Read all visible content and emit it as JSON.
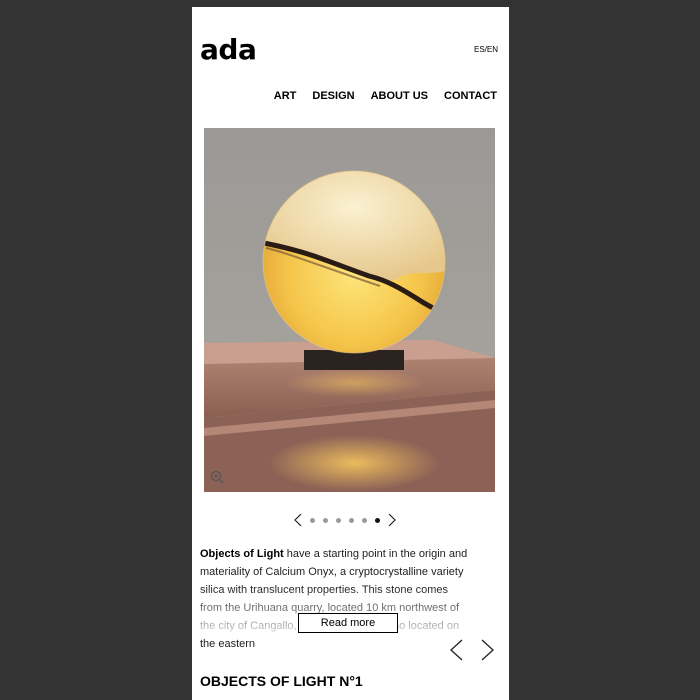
{
  "header": {
    "logo": "ada",
    "lang_switch": "ES/EN"
  },
  "nav": {
    "items": [
      {
        "label": "ART"
      },
      {
        "label": "DESIGN"
      },
      {
        "label": "ABOUT US"
      },
      {
        "label": "CONTACT"
      }
    ]
  },
  "hero": {
    "icon": "zoom-icon"
  },
  "carousel": {
    "slide_count": 6,
    "active_index": 5
  },
  "description": {
    "lead": "Objects of Light",
    "text": " have a starting point in the origin and materiality of Calcium Onyx, a cryptocrystalline variety silica with translucent properties. This stone comes from the Urihuana quarry, located 10 km northwest of the city of Cangallo, in Ayacucho. It is also located on the eastern"
  },
  "read_more_label": "Read more",
  "section": {
    "title": "OBJECTS OF LIGHT N°1"
  },
  "colors": {
    "background": "#333333",
    "page": "#ffffff",
    "text": "#000000"
  }
}
